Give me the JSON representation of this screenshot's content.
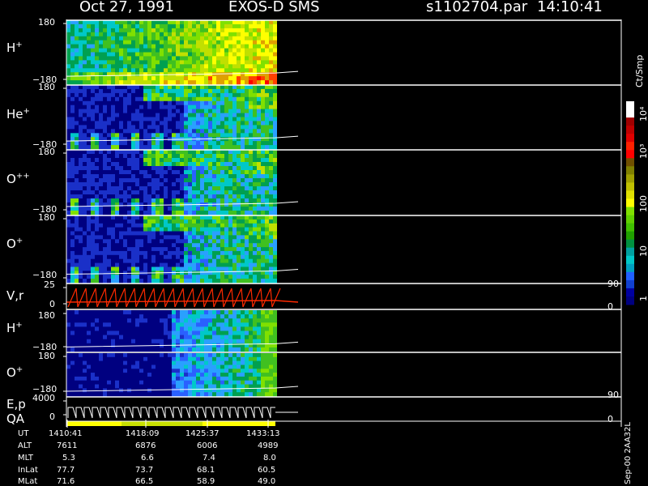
{
  "header": {
    "date": "Oct 27, 1991",
    "instrument": "EXOS-D SMS",
    "file": "s1102704.par",
    "time": "14:10:41"
  },
  "panels": [
    {
      "id": "h1",
      "label_main": "H",
      "label_sup": "+",
      "ymax": "180",
      "ymin": "−180"
    },
    {
      "id": "he",
      "label_main": "He",
      "label_sup": "+",
      "ymax": "180",
      "ymin": "−180"
    },
    {
      "id": "opp",
      "label_main": "O",
      "label_sup": "++",
      "ymax": "180",
      "ymin": "−180"
    },
    {
      "id": "o1",
      "label_main": "O",
      "label_sup": "+",
      "ymax": "180",
      "ymin": "−180"
    },
    {
      "id": "vr",
      "label_main": "V,r",
      "label_sup": "",
      "ymax": "25",
      "ymin": "0",
      "rmax": "90",
      "rmin": "0"
    },
    {
      "id": "h2",
      "label_main": "H",
      "label_sup": "+",
      "ymax": "180",
      "ymin": "−180"
    },
    {
      "id": "o2",
      "label_main": "O",
      "label_sup": "+",
      "ymax": "180",
      "ymin": "−180"
    },
    {
      "id": "ep",
      "label_main": "E,p",
      "label_sup": "",
      "ymax": "4000",
      "ymin": "0",
      "rmax": "90",
      "rmin": "0"
    }
  ],
  "qa_label": "QA",
  "colorbar": {
    "unit": "Ct/Smp",
    "ticks": [
      "1",
      "10",
      "100",
      "10³",
      "10⁴"
    ]
  },
  "footer": {
    "rows": [
      {
        "label": "UT",
        "values": [
          "1410:41",
          "1418:09",
          "1425:37",
          "1433:13"
        ]
      },
      {
        "label": "ALT",
        "values": [
          "7611",
          "6876",
          "6006",
          "4989"
        ]
      },
      {
        "label": "MLT",
        "values": [
          "5.3",
          "6.6",
          "7.4",
          "8.0"
        ]
      },
      {
        "label": "InLat",
        "values": [
          "77.7",
          "73.7",
          "68.1",
          "60.5"
        ]
      },
      {
        "label": "MLat",
        "values": [
          "71.6",
          "66.5",
          "58.9",
          "49.0"
        ]
      }
    ],
    "side_note": "Sep-00 2AA32L"
  },
  "colors": {
    "bg": "#000000",
    "bar_lo": "#000080",
    "bar_hi": "#ffffff",
    "red_trace": "#ff2a00",
    "qa_yellow": "#ffff00"
  },
  "chart_data": {
    "type": "heatmap",
    "title": "Oct 27, 1991 EXOS-D SMS",
    "x": [
      "1410:41",
      "1418:09",
      "1425:37",
      "1433:13"
    ],
    "panels": [
      "H+",
      "He+",
      "O++",
      "O+",
      "V,r",
      "H+",
      "O+",
      "E,p"
    ],
    "ylim_pitch": [
      -180,
      180
    ],
    "ylim_vr": [
      0,
      25
    ],
    "ylim_ep": [
      0,
      4000
    ],
    "colorbar": {
      "label": "Ct/Smp",
      "scale": "log",
      "range": [
        1,
        10000
      ]
    },
    "grid": false,
    "legend": "right"
  }
}
